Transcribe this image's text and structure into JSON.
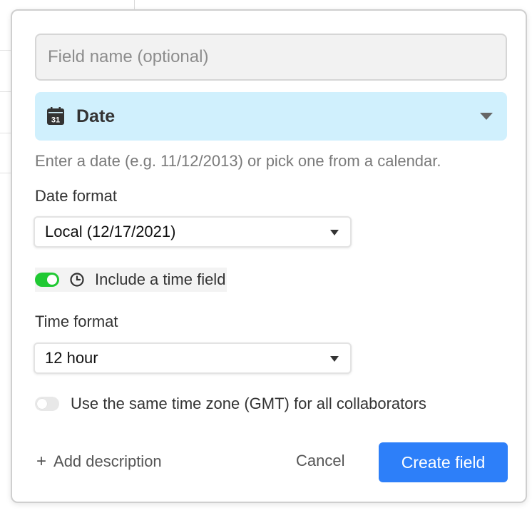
{
  "dialog": {
    "field_name": {
      "value": "",
      "placeholder": "Field name (optional)"
    },
    "field_type": {
      "label": "Date",
      "icon": "calendar-icon",
      "icon_text": "31",
      "highlight_color": "#d0f0fd"
    },
    "helper_text": "Enter a date (e.g. 11/12/2013) or pick one from a calendar.",
    "date_format": {
      "label": "Date format",
      "selected": "Local (12/17/2021)"
    },
    "include_time": {
      "label": "Include a time field",
      "enabled": true,
      "icon": "clock-icon",
      "toggle_color": "#20c933"
    },
    "time_format": {
      "label": "Time format",
      "selected": "12 hour"
    },
    "same_timezone": {
      "label": "Use the same time zone (GMT) for all collaborators",
      "enabled": false
    },
    "actions": {
      "add_description": "Add description",
      "cancel": "Cancel",
      "create": "Create field",
      "primary_color": "#2d7ff9"
    }
  }
}
